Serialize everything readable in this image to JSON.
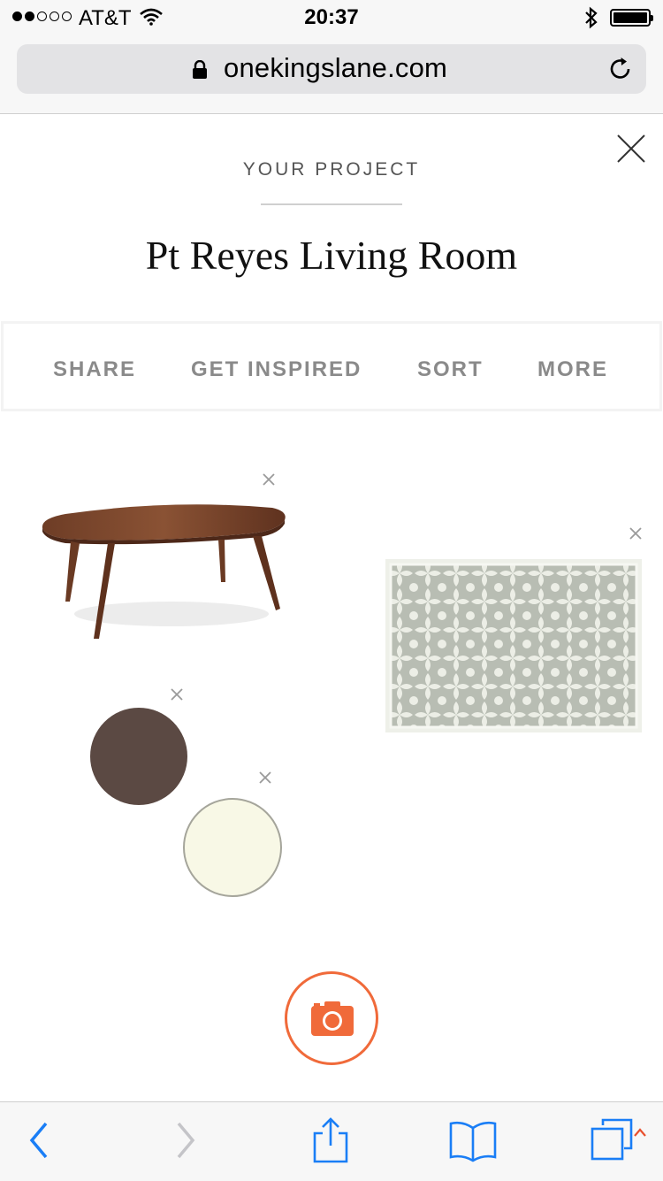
{
  "status_bar": {
    "carrier": "AT&T",
    "time": "20:37",
    "signal_bars_filled": 2,
    "signal_bars_total": 5
  },
  "browser": {
    "url": "onekingslane.com"
  },
  "project": {
    "eyebrow": "YOUR PROJECT",
    "title": "Pt Reyes Living Room"
  },
  "actions": [
    {
      "label": "SHARE"
    },
    {
      "label": "GET INSPIRED"
    },
    {
      "label": "SORT"
    },
    {
      "label": "MORE"
    }
  ],
  "board": {
    "swatches": [
      {
        "name": "dark brown paint",
        "color": "#5b4943"
      },
      {
        "name": "cream paint",
        "color": "#f8f8e6"
      }
    ]
  },
  "colors": {
    "accent": "#f06a3a",
    "ios_blue": "#1a7ef6",
    "disabled": "#c4c4c8"
  }
}
